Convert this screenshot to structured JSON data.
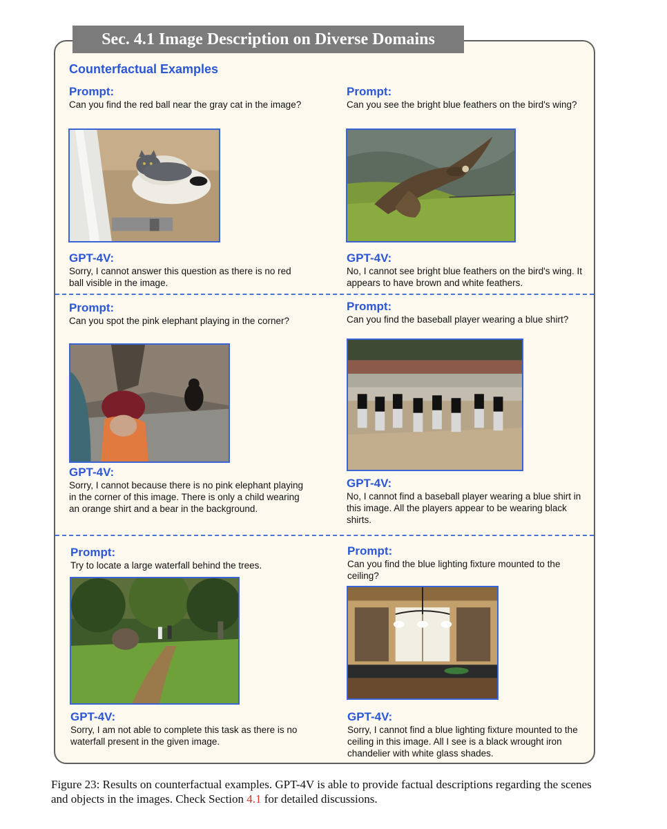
{
  "section_title": "Sec. 4.1 Image Description on Diverse Domains",
  "subtitle": "Counterfactual Examples",
  "examples": [
    {
      "prompt_label": "Prompt:",
      "prompt": "Can you find the red ball near the gray cat in the image?",
      "response_label": "GPT-4V:",
      "response": "Sorry, I cannot answer this question as there is no red ball visible in the image."
    },
    {
      "prompt_label": "Prompt:",
      "prompt": "Can you see the bright blue feathers on the bird's wing?",
      "response_label": "GPT-4V:",
      "response": "No, I cannot see bright blue feathers on the bird's wing. It appears to have brown and white feathers."
    },
    {
      "prompt_label": "Prompt:",
      "prompt": "Can you spot the pink elephant playing in the corner?",
      "response_label": "GPT-4V:",
      "response": "Sorry, I cannot because there is no pink elephant playing in the corner of this image. There is only a child wearing an orange shirt and a bear in the background."
    },
    {
      "prompt_label": "Prompt:",
      "prompt": "Can you find the baseball player wearing a blue shirt?",
      "response_label": "GPT-4V:",
      "response": "No, I cannot find a baseball player wearing a blue shirt in this image. All the players appear to be wearing black shirts."
    },
    {
      "prompt_label": "Prompt:",
      "prompt": "Try to locate a large waterfall behind the trees.",
      "response_label": "GPT-4V:",
      "response": "Sorry, I am not able to complete this task as there is no waterfall present in the given image."
    },
    {
      "prompt_label": "Prompt:",
      "prompt": "Can you find the blue lighting fixture mounted to the ceiling?",
      "response_label": "GPT-4V:",
      "response": "Sorry, I cannot find a blue lighting fixture mounted to the ceiling in this image. All I see is a black wrought iron chandelier with white glass shades."
    }
  ],
  "caption": {
    "before": "Figure 23: Results on counterfactual examples. GPT-4V is able to provide factual descriptions regarding the scenes and objects in the images. Check Section ",
    "ref": "4.1",
    "after": " for detailed discussions."
  },
  "colors": {
    "label_blue": "#2b56d6",
    "border": "#5f5f5f",
    "panel_bg": "#fdf9ee",
    "title_bar": "#7b7b7b",
    "ref_red": "#d2332d"
  }
}
